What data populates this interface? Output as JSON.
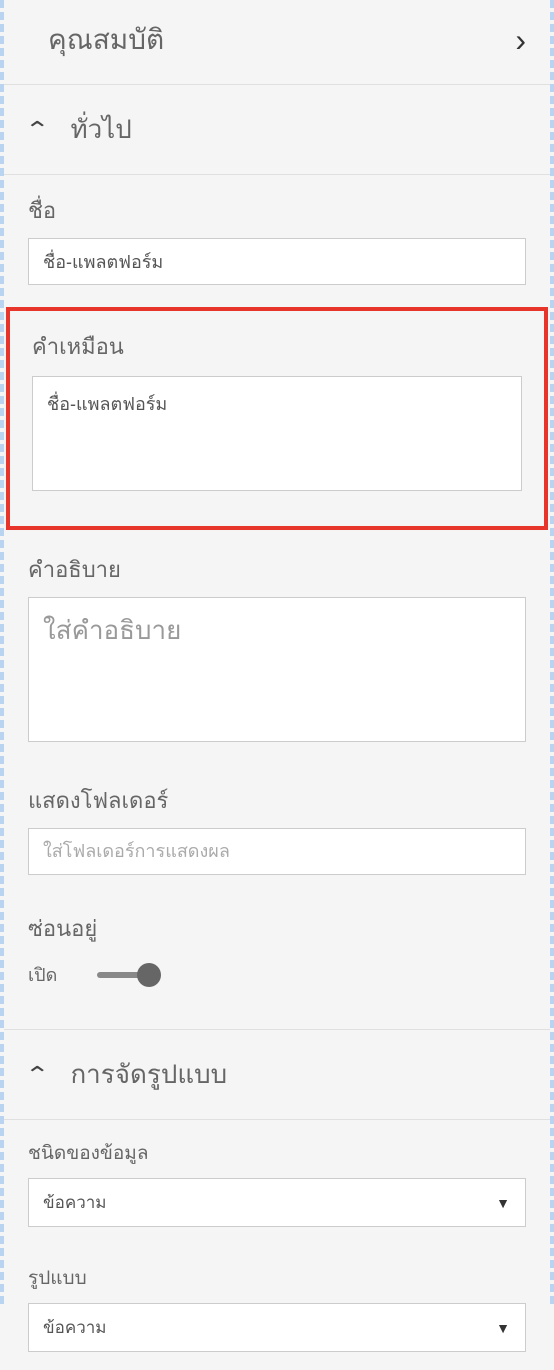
{
  "panel": {
    "title": "คุณสมบัติ"
  },
  "sections": {
    "general": {
      "title": "ทั่วไป",
      "name": {
        "label": "ชื่อ",
        "value": "ชื่อ-แพลตฟอร์ม"
      },
      "synonym": {
        "label": "คำเหมือน",
        "value": "ชื่อ-แพลตฟอร์ม"
      },
      "description": {
        "label": "คำอธิบาย",
        "placeholder": "ใส่คำอธิบาย"
      },
      "displayFolder": {
        "label": "แสดงโฟลเดอร์",
        "placeholder": "ใส่โฟลเดอร์การแสดงผล"
      },
      "hidden": {
        "label": "ซ่อนอยู่",
        "status": "เปิด"
      }
    },
    "formatting": {
      "title": "การจัดรูปแบบ",
      "dataType": {
        "label": "ชนิดของข้อมูล",
        "value": "ข้อความ"
      },
      "format": {
        "label": "รูปแบบ",
        "value": "ข้อความ"
      }
    }
  }
}
